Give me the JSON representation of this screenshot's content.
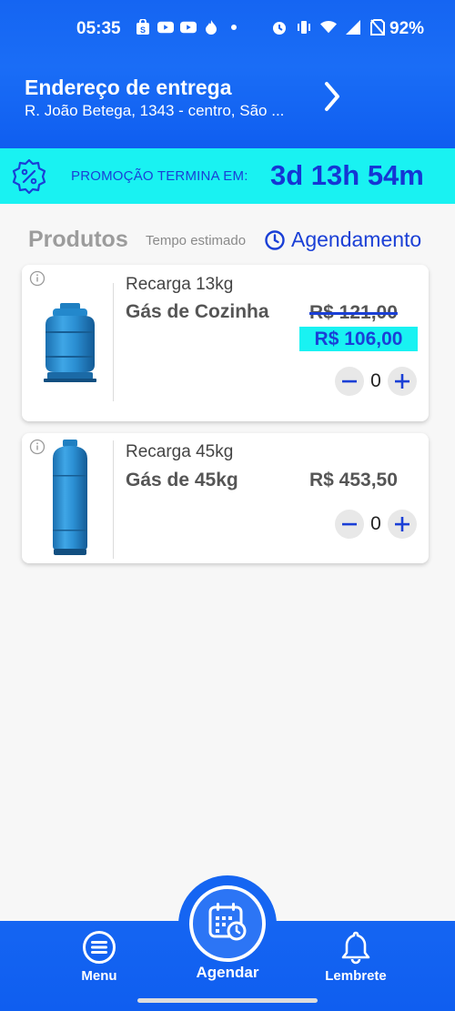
{
  "status_bar": {
    "time": "05:35",
    "battery": "92%"
  },
  "header": {
    "address_title": "Endereço de entrega",
    "address_line": "R. João Betega, 1343 - centro, São ...",
    "chevron_icon": "chevron-right-icon"
  },
  "promo": {
    "label": "PROMOÇÃO TERMINA EM:",
    "timer": "3d 13h 54m",
    "icon": "percent-badge-icon"
  },
  "products_section": {
    "title": "Produtos",
    "tempo_label": "Tempo estimado",
    "agendamento_label": "Agendamento"
  },
  "products": [
    {
      "subtitle": "Recarga 13kg",
      "name": "Gás de Cozinha",
      "old_price": "R$ 121,00",
      "price": "R$ 106,00",
      "quantity": "0"
    },
    {
      "subtitle": "Recarga 45kg",
      "name": "Gás de 45kg",
      "price": "R$ 453,50",
      "quantity": "0"
    }
  ],
  "bottom_nav": {
    "menu_label": "Menu",
    "agendar_label": "Agendar",
    "lembrete_label": "Lembrete"
  },
  "colors": {
    "primary_blue": "#1565f2",
    "accent_cyan": "#19f2f2",
    "dark_blue_text": "#1a3fd6"
  }
}
